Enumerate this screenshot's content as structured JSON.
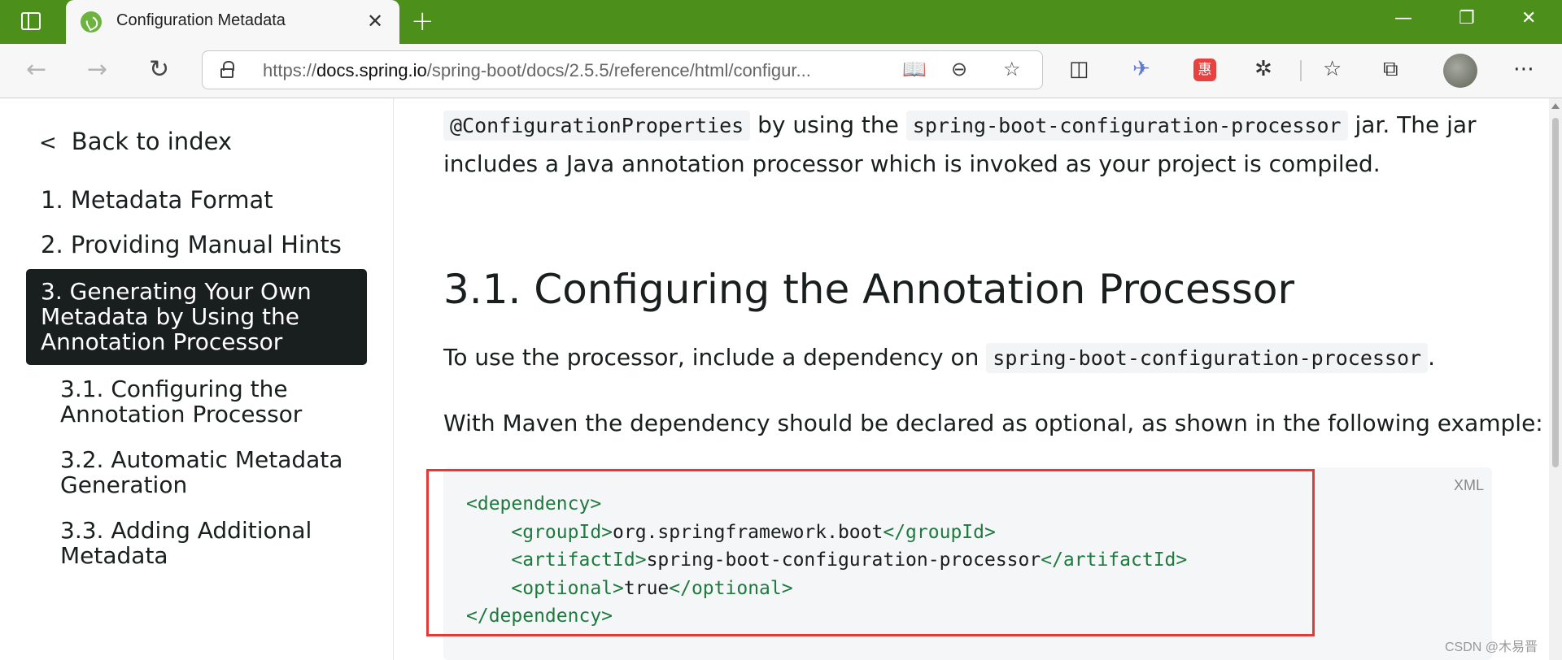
{
  "browser": {
    "tab_title": "Configuration Metadata",
    "url_prefix": "https://",
    "url_host": "docs.spring.io",
    "url_path": "/spring-boot/docs/2.5.5/reference/html/configur...",
    "ext_badge_1": "惠",
    "colors": {
      "titlebar": "#4d8f1b",
      "favicon": "#6db33f"
    }
  },
  "leftnav": {
    "back_label": "Back to index",
    "items": [
      "1. Metadata Format",
      "2. Providing Manual Hints",
      "3. Generating Your Own Metadata by Using the Annotation Processor"
    ],
    "sub_items": [
      "3.1. Configuring the Annotation Processor",
      "3.2. Automatic Metadata Generation",
      "3.3. Adding Additional Metadata"
    ]
  },
  "content": {
    "para1_code1": "@ConfigurationProperties",
    "para1_text1": " by using the ",
    "para1_code2": "spring-boot-configuration-processor",
    "para1_text2": " jar. The jar",
    "para1_line2": "includes a Java annotation processor which is invoked as your project is compiled.",
    "heading": "3.1. Configuring the Annotation Processor",
    "para2_text": "To use the processor, include a dependency on ",
    "para2_code": "spring-boot-configuration-processor",
    "para2_end": ".",
    "para3": "With Maven the dependency should be declared as optional, as shown in the following example:",
    "code_lang": "XML",
    "code": {
      "l1_open": "<dependency>",
      "l2_open": "<groupId>",
      "l2_val": "org.springframework.boot",
      "l2_close": "</groupId>",
      "l3_open": "<artifactId>",
      "l3_val": "spring-boot-configuration-processor",
      "l3_close": "</artifactId>",
      "l4_open": "<optional>",
      "l4_val": "true",
      "l4_close": "</optional>",
      "l5_close": "</dependency>"
    }
  },
  "watermark": "CSDN @木易晋"
}
